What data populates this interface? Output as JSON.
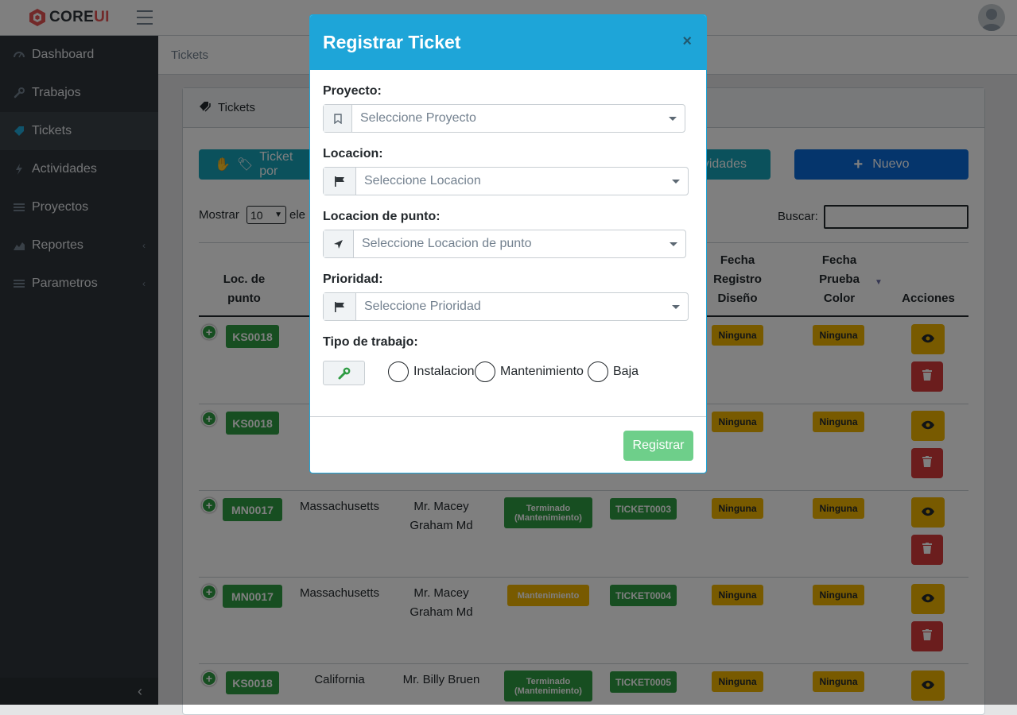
{
  "brand": {
    "name_core": "CORE",
    "name_ui": "UI"
  },
  "sidebar": {
    "items": [
      {
        "label": "Dashboard",
        "icon": "speedometer-icon"
      },
      {
        "label": "Trabajos",
        "icon": "wrench-icon"
      },
      {
        "label": "Tickets",
        "icon": "tag-icon"
      },
      {
        "label": "Actividades",
        "icon": "bolt-icon"
      },
      {
        "label": "Proyectos",
        "icon": "list-icon"
      },
      {
        "label": "Reportes",
        "icon": "chart-icon"
      },
      {
        "label": "Parametros",
        "icon": "list-icon"
      }
    ],
    "minimizer": "‹"
  },
  "breadcrumb": "Tickets",
  "card": {
    "title": "Tickets",
    "btn_ticket_por": "Ticket por",
    "btn_actividades": "vidades",
    "btn_nuevo": "Nuevo",
    "mostrar_label": "Mostrar",
    "mostrar_value": "10",
    "mostrar_suffix": "ele",
    "buscar_label": "Buscar:"
  },
  "table": {
    "headers": {
      "loc_punto": [
        "Loc. de",
        "punto"
      ],
      "fecha_registro": [
        "Fecha",
        "Registro",
        "Diseño"
      ],
      "fecha_prueba": [
        "Fecha",
        "Prueba",
        "Color"
      ],
      "acciones": "Acciones"
    },
    "rows": [
      {
        "loc": "KS0018",
        "state": "",
        "name": [
          "",
          ""
        ],
        "status": "",
        "ticket": "",
        "fecha1": "Ninguna",
        "fecha2": "Ninguna"
      },
      {
        "loc": "KS0018",
        "state": "",
        "name": [
          "",
          ""
        ],
        "status": "",
        "ticket": "",
        "fecha1": "Ninguna",
        "fecha2": "Ninguna"
      },
      {
        "loc": "MN0017",
        "state": "Massachusetts",
        "name": [
          "Mr. Macey",
          "Graham Md"
        ],
        "status": [
          "Terminado",
          "(Mantenimiento)"
        ],
        "ticket": "TICKET0003",
        "fecha1": "Ninguna",
        "fecha2": "Ninguna"
      },
      {
        "loc": "MN0017",
        "state": "Massachusetts",
        "name": [
          "Mr. Macey",
          "Graham Md"
        ],
        "status": [
          "Mantenimiento"
        ],
        "ticket": "TICKET0004",
        "fecha1": "Ninguna",
        "fecha2": "Ninguna"
      },
      {
        "loc": "KS0018",
        "state": "California",
        "name": [
          "Mr. Billy Bruen",
          ""
        ],
        "status": [
          "Terminado",
          "(Mantenimiento)"
        ],
        "ticket": "TICKET0005",
        "fecha1": "Ninguna",
        "fecha2": "Ninguna"
      }
    ]
  },
  "modal": {
    "title": "Registrar Ticket",
    "close": "×",
    "proyecto_label": "Proyecto:",
    "proyecto_placeholder": "Seleccione Proyecto",
    "locacion_label": "Locacion:",
    "locacion_placeholder": "Seleccione Locacion",
    "locacion_punto_label": "Locacion de punto:",
    "locacion_punto_placeholder": "Seleccione Locacion de punto",
    "prioridad_label": "Prioridad:",
    "prioridad_placeholder": "Seleccione Prioridad",
    "tipo_label": "Tipo de trabajo:",
    "tipo_options": [
      "Instalacion",
      "Mantenimiento",
      "Baja"
    ],
    "submit": "Registrar"
  },
  "colors": {
    "primary": "#1ea5d8",
    "success": "#2e9c43",
    "warning": "#f0b400",
    "danger": "#d63a3a",
    "sidebar": "#2f353a"
  }
}
